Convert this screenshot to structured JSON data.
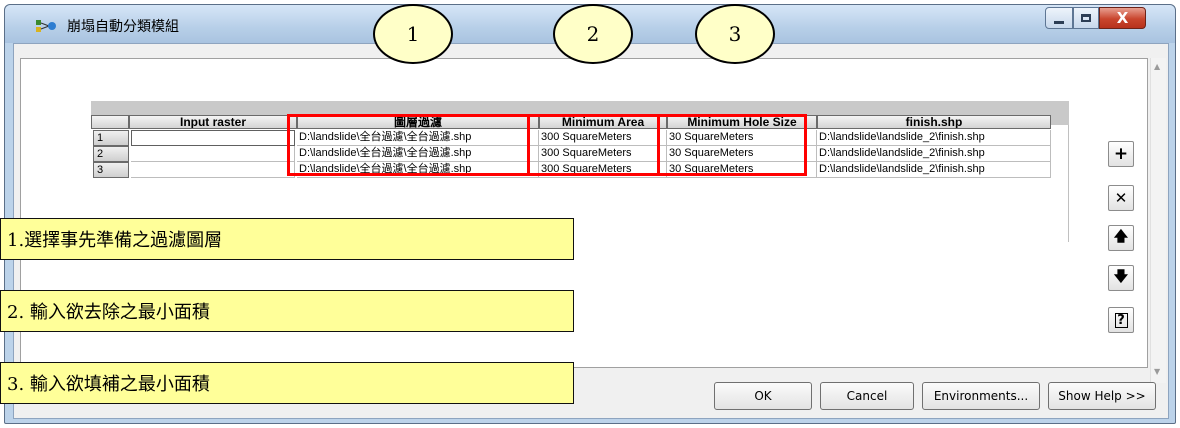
{
  "window": {
    "title": "崩塌自動分類模組",
    "close_glyph": "X"
  },
  "table": {
    "columns": [
      "",
      "Input raster",
      "圖層過濾",
      "Minimum Area",
      "Minimum Hole Size",
      "finish.shp"
    ],
    "rows": [
      {
        "num": "1",
        "input": "",
        "filter": "D:\\landslide\\全台過濾\\全台過濾.shp",
        "min_area": "300 SquareMeters",
        "min_hole": "30 SquareMeters",
        "finish": "D:\\landslide\\landslide_2\\finish.shp"
      },
      {
        "num": "2",
        "input": "",
        "filter": "D:\\landslide\\全台過濾\\全台過濾.shp",
        "min_area": "300 SquareMeters",
        "min_hole": "30 SquareMeters",
        "finish": "D:\\landslide\\landslide_2\\finish.shp"
      },
      {
        "num": "3",
        "input": "",
        "filter": "D:\\landslide\\全台過濾\\全台過濾.shp",
        "min_area": "300 SquareMeters",
        "min_hole": "30 SquareMeters",
        "finish": "D:\\landslide\\landslide_2\\finish.shp"
      }
    ]
  },
  "side_buttons": [
    {
      "icon": "plus-icon",
      "glyph": "+"
    },
    {
      "icon": "delete-icon",
      "glyph": "✕"
    },
    {
      "icon": "arrow-up-icon",
      "glyph": "🡅"
    },
    {
      "icon": "arrow-down-icon",
      "glyph": "🡇"
    },
    {
      "icon": "help-icon",
      "glyph": "?"
    }
  ],
  "buttons": {
    "ok": "OK",
    "cancel": "Cancel",
    "environments": "Environments...",
    "show_help": "Show Help >>"
  },
  "callouts": [
    "1",
    "2",
    "3"
  ],
  "notes": [
    "1.選擇事先準備之過濾圖層",
    "2.  輸入欲去除之最小面積",
    "3.  輸入欲填補之最小面積"
  ],
  "colors": {
    "highlight": "#ff0000",
    "note_bg": "#ffff99",
    "close_button": "#c9452d"
  }
}
